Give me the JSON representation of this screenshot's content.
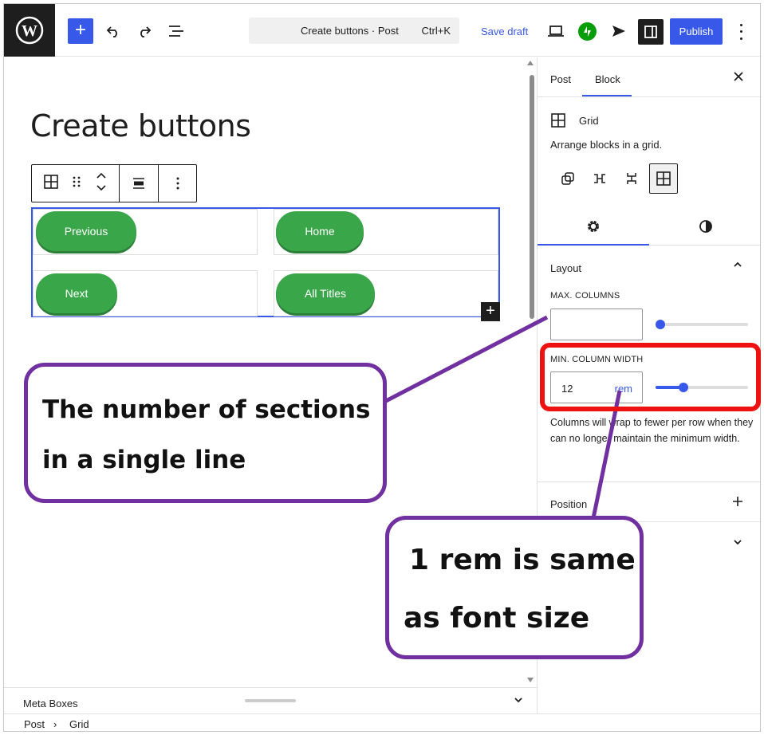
{
  "topbar": {
    "command_title": "Create buttons · Post",
    "command_shortcut": "Ctrl+K",
    "save_draft": "Save draft",
    "publish": "Publish"
  },
  "editor": {
    "post_title": "Create buttons",
    "grid_buttons": [
      "Previous",
      "Home",
      "Next",
      "All Titles"
    ],
    "inserter": "+"
  },
  "meta_boxes": {
    "label": "Meta Boxes"
  },
  "breadcrumb": {
    "items": [
      "Post",
      "Grid"
    ],
    "separator": "›"
  },
  "sidebar": {
    "tabs": [
      "Post",
      "Block"
    ],
    "active_tab": "Block",
    "block": {
      "name": "Grid",
      "description": "Arrange blocks in a grid."
    },
    "layout": {
      "title": "Layout",
      "max_columns_label": "Max. Columns",
      "max_columns_value": "",
      "min_width_label": "Min. Column Width",
      "min_width_value": "12",
      "min_width_unit": "rem",
      "max_columns_slider": 0,
      "min_width_slider": 0.3,
      "help": "Columns will wrap to fewer per row when they can no longer maintain the minimum width."
    },
    "position_title": "Position"
  },
  "annotations": {
    "callout_left": [
      "The number of sections",
      "in a single line"
    ],
    "callout_right": [
      "1 rem is same",
      "as font size"
    ],
    "highlight_color": "#ee1111",
    "callout_border_color": "#7030a0"
  },
  "colors": {
    "accent": "#3858e9",
    "button_green": "#3aa64a",
    "dark": "#1e1e1e"
  }
}
